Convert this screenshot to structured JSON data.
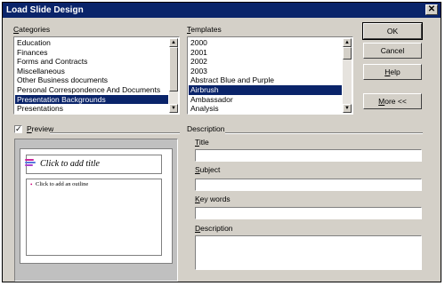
{
  "window": {
    "title": "Load Slide Design",
    "close_glyph": "✕"
  },
  "categories": {
    "label": "Categories",
    "items": [
      "Education",
      "Finances",
      "Forms and Contracts",
      "Miscellaneous",
      "Other Business documents",
      "Personal Correspondence And Documents",
      "Presentation Backgrounds",
      "Presentations"
    ],
    "selected": "Presentation Backgrounds"
  },
  "templates": {
    "label": "Templates",
    "items": [
      "2000",
      "2001",
      "2002",
      "2003",
      "Abstract Blue and Purple",
      "Airbrush",
      "Ambassador",
      "Analysis"
    ],
    "selected": "Airbrush"
  },
  "buttons": {
    "ok": "OK",
    "cancel": "Cancel",
    "help": "Help",
    "more": "More <<"
  },
  "preview": {
    "label": "Preview",
    "checked": true,
    "check_glyph": "✓",
    "slide_title": "Click to add title",
    "slide_outline": "Click to add an outline",
    "bullet_glyph": "•",
    "bar_colors": [
      "#cc2299",
      "#5577dd",
      "#aa44cc"
    ]
  },
  "description": {
    "group_label": "Description",
    "title_label": "Title",
    "subject_label": "Subject",
    "keywords_label": "Key words",
    "description_label": "Description",
    "title_value": "",
    "subject_value": "",
    "keywords_value": "",
    "description_value": ""
  },
  "scroll": {
    "up_glyph": "▲",
    "down_glyph": "▼"
  }
}
